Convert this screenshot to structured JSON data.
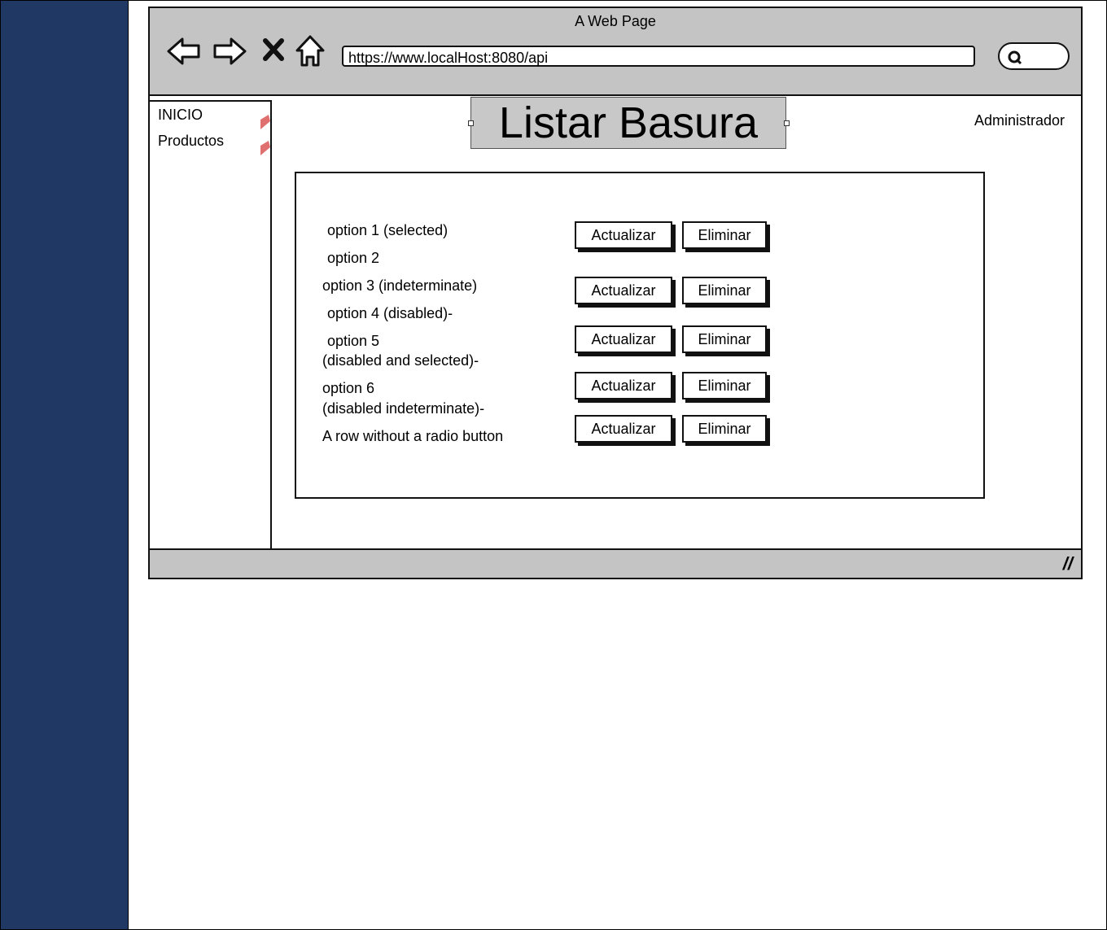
{
  "window": {
    "title": "A Web Page"
  },
  "toolbar": {
    "url": "https://www.localHost:8080/api",
    "icons": [
      "back-arrow-icon",
      "forward-arrow-icon",
      "close-icon",
      "home-icon",
      "search-icon"
    ]
  },
  "sidebar": {
    "items": [
      {
        "label": "INICIO"
      },
      {
        "label": "Productos"
      }
    ]
  },
  "header": {
    "title": "Listar Basura",
    "user": "Administrador"
  },
  "options": [
    {
      "label": "option 1 (selected)"
    },
    {
      "label": "option 2"
    },
    {
      "label": "option 3 (indeterminate)"
    },
    {
      "label": "option 4 (disabled)-"
    },
    {
      "label": "option 5"
    },
    {
      "label": "(disabled and selected)-"
    },
    {
      "label": "option 6"
    },
    {
      "label": "(disabled indeterminate)-"
    },
    {
      "label": "A row without a radio button"
    }
  ],
  "actions": {
    "update_label": "Actualizar",
    "delete_label": "Eliminar"
  },
  "colors": {
    "left_band": "#1f3864",
    "chrome_gray": "#c4c4c4",
    "arrow_accent": "#e07070"
  }
}
